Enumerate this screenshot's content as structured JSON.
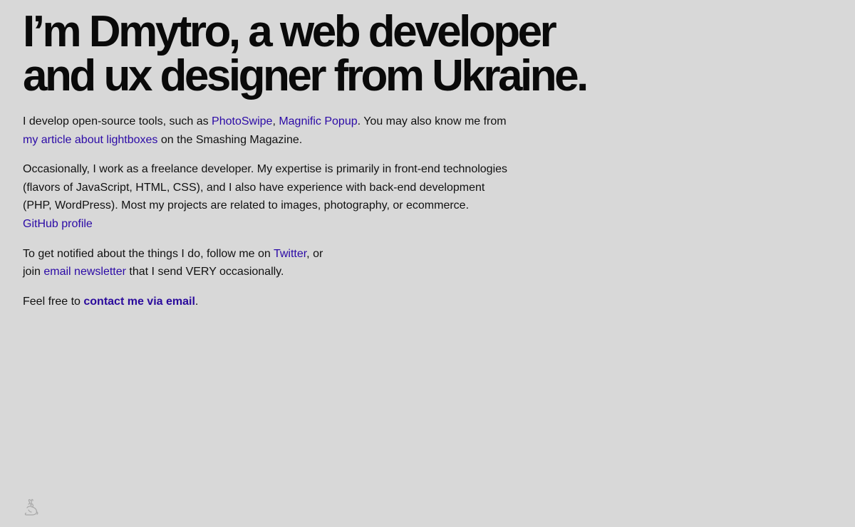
{
  "heading": {
    "line1": "I’m Dmytro, a web developer",
    "line2": "and ux designer from Ukraine."
  },
  "intro": {
    "text1": "I develop open-source tools, such as ",
    "link_photoswipe": "PhotoSwipe",
    "sep": ", ",
    "link_magnific": "Magnific Popup",
    "text2": ". You may also know me from",
    "link_article": "my article about lightboxes",
    "text3": " on the Smashing Magazine."
  },
  "freelance": {
    "line1": "Occasionally, I work as a freelance developer. My expertise is primarily in front-end technologies",
    "line2": "(flavors of JavaScript, HTML, CSS), and I also have experience with back-end development",
    "line3": "(PHP, WordPress). Most my projects are related to images, photography, or ecommerce.",
    "link_github": "GitHub profile"
  },
  "notify": {
    "text1": "To get notified about the things I do, follow me on ",
    "link_twitter": "Twitter",
    "text2": ", or",
    "text3": "join ",
    "link_newsletter": "email newsletter",
    "text4": " that I send VERY occasionally."
  },
  "contact": {
    "text1": "Feel free to ",
    "link_email": "contact me via email",
    "text2": "."
  },
  "colors": {
    "background": "#d8d8d8",
    "text": "#111111",
    "link": "#2b0aa6"
  },
  "icons": {
    "mascot": "rabbit-outline-icon"
  }
}
